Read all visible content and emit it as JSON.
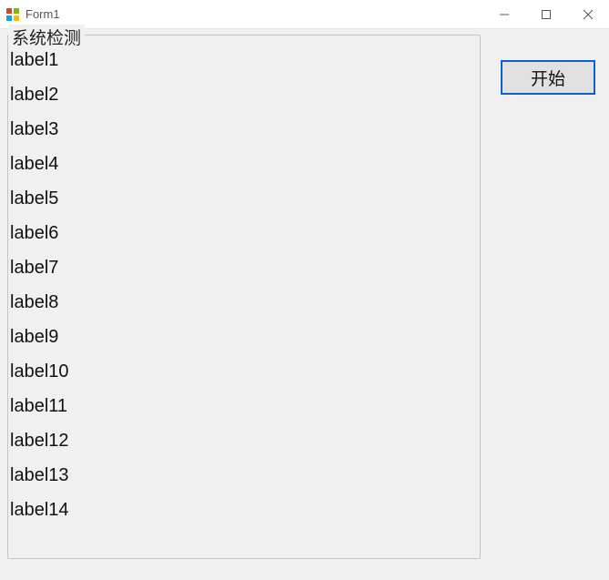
{
  "window": {
    "title": "Form1"
  },
  "groupbox": {
    "title": "系统检测",
    "labels": [
      "label1",
      "label2",
      "label3",
      "label4",
      "label5",
      "label6",
      "label7",
      "label8",
      "label9",
      "label10",
      "label11",
      "label12",
      "label13",
      "label14"
    ]
  },
  "buttons": {
    "start": "开始"
  }
}
